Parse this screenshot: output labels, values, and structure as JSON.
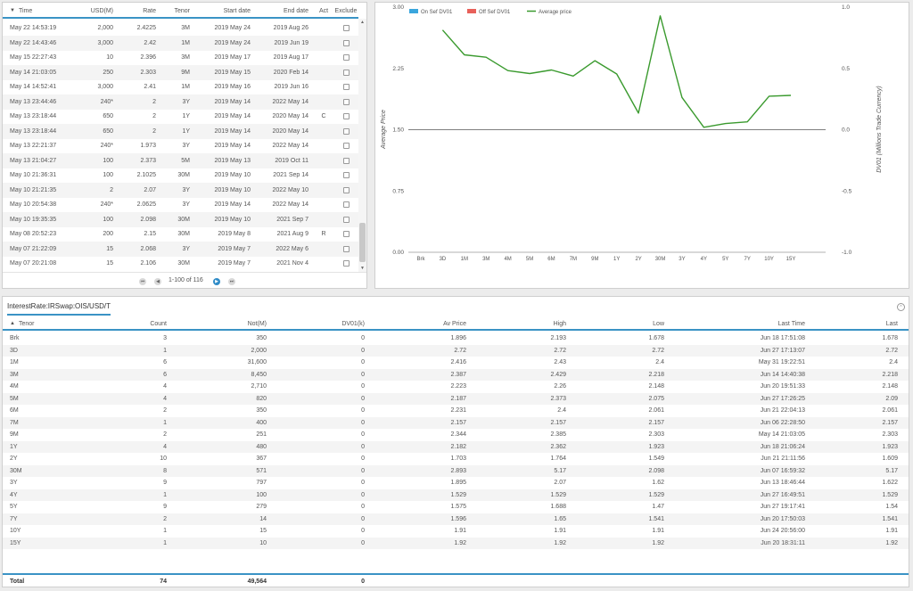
{
  "trades": {
    "columns": {
      "time": "Time",
      "usd": "USD(M)",
      "rate": "Rate",
      "tenor": "Tenor",
      "start": "Start date",
      "end": "End date",
      "act": "Act",
      "exclude": "Exclude"
    },
    "rows": [
      {
        "time": "May 22 14:53:19",
        "usd": "2,000",
        "rate": "2.4225",
        "tenor": "3M",
        "start": "2019 May 24",
        "end": "2019 Aug 26",
        "act": ""
      },
      {
        "time": "May 22 14:43:46",
        "usd": "3,000",
        "rate": "2.42",
        "tenor": "1M",
        "start": "2019 May 24",
        "end": "2019 Jun 19",
        "act": ""
      },
      {
        "time": "May 15 22:27:43",
        "usd": "10",
        "rate": "2.396",
        "tenor": "3M",
        "start": "2019 May 17",
        "end": "2019 Aug 17",
        "act": ""
      },
      {
        "time": "May 14 21:03:05",
        "usd": "250",
        "rate": "2.303",
        "tenor": "9M",
        "start": "2019 May 15",
        "end": "2020 Feb 14",
        "act": ""
      },
      {
        "time": "May 14 14:52:41",
        "usd": "3,000",
        "rate": "2.41",
        "tenor": "1M",
        "start": "2019 May 16",
        "end": "2019 Jun 16",
        "act": ""
      },
      {
        "time": "May 13 23:44:46",
        "usd": "240*",
        "rate": "2",
        "tenor": "3Y",
        "start": "2019 May 14",
        "end": "2022 May 14",
        "act": ""
      },
      {
        "time": "May 13 23:18:44",
        "usd": "650",
        "rate": "2",
        "tenor": "1Y",
        "start": "2019 May 14",
        "end": "2020 May 14",
        "act": "C"
      },
      {
        "time": "May 13 23:18:44",
        "usd": "650",
        "rate": "2",
        "tenor": "1Y",
        "start": "2019 May 14",
        "end": "2020 May 14",
        "act": ""
      },
      {
        "time": "May 13 22:21:37",
        "usd": "240*",
        "rate": "1.973",
        "tenor": "3Y",
        "start": "2019 May 14",
        "end": "2022 May 14",
        "act": ""
      },
      {
        "time": "May 13 21:04:27",
        "usd": "100",
        "rate": "2.373",
        "tenor": "5M",
        "start": "2019 May 13",
        "end": "2019 Oct 11",
        "act": ""
      },
      {
        "time": "May 10 21:36:31",
        "usd": "100",
        "rate": "2.1025",
        "tenor": "30M",
        "start": "2019 May 10",
        "end": "2021 Sep 14",
        "act": ""
      },
      {
        "time": "May 10 21:21:35",
        "usd": "2",
        "rate": "2.07",
        "tenor": "3Y",
        "start": "2019 May 10",
        "end": "2022 May 10",
        "act": ""
      },
      {
        "time": "May 10 20:54:38",
        "usd": "240*",
        "rate": "2.0625",
        "tenor": "3Y",
        "start": "2019 May 14",
        "end": "2022 May 14",
        "act": ""
      },
      {
        "time": "May 10 19:35:35",
        "usd": "100",
        "rate": "2.098",
        "tenor": "30M",
        "start": "2019 May 10",
        "end": "2021 Sep 7",
        "act": ""
      },
      {
        "time": "May 08 20:52:23",
        "usd": "200",
        "rate": "2.15",
        "tenor": "30M",
        "start": "2019 May 8",
        "end": "2021 Aug 9",
        "act": "R"
      },
      {
        "time": "May 07 21:22:09",
        "usd": "15",
        "rate": "2.068",
        "tenor": "3Y",
        "start": "2019 May 7",
        "end": "2022 May 6",
        "act": ""
      },
      {
        "time": "May 07 20:21:08",
        "usd": "15",
        "rate": "2.106",
        "tenor": "30M",
        "start": "2019 May 7",
        "end": "2021 Nov 4",
        "act": ""
      }
    ],
    "pager": {
      "label": "1-100 of 116"
    }
  },
  "chart_data": {
    "type": "line",
    "legend": [
      "On Sef DV01",
      "Off Sef DV01",
      "Average price"
    ],
    "legend_colors": [
      "#3aa6dd",
      "#e8605a",
      "#3a9a2e"
    ],
    "legend_placement": "top-left",
    "categories": [
      "Brk",
      "3D",
      "1M",
      "3M",
      "4M",
      "5M",
      "6M",
      "7M",
      "9M",
      "1Y",
      "2Y",
      "30M",
      "3Y",
      "4Y",
      "5Y",
      "7Y",
      "10Y",
      "15Y"
    ],
    "series": [
      {
        "name": "Average price",
        "axis": "left",
        "color": "#3a9a2e",
        "values": [
          null,
          2.72,
          2.416,
          2.387,
          2.223,
          2.187,
          2.231,
          2.157,
          2.344,
          2.182,
          1.703,
          2.893,
          1.895,
          1.529,
          1.575,
          1.596,
          1.91,
          1.92
        ]
      }
    ],
    "ylabel": "Average Price",
    "y2label": "DV01 (Millions Trade Currency)",
    "ylim": [
      0,
      3
    ],
    "yticks": [
      "0.00",
      "0.75",
      "1.50",
      "2.25",
      "3.00"
    ],
    "y2lim": [
      -1,
      1
    ],
    "y2ticks": [
      "-1.0",
      "-0.5",
      "0.0",
      "0.5",
      "1.0"
    ],
    "zero_line": 1.5,
    "grid": false
  },
  "summary": {
    "tab": "InterestRate:IRSwap:OIS/USD/T",
    "columns": {
      "tenor": "Tenor",
      "count": "Count",
      "not": "Not(M)",
      "dv01": "DV01(k)",
      "avprice": "Av Price",
      "high": "High",
      "low": "Low",
      "lasttime": "Last Time",
      "last": "Last"
    },
    "rows": [
      {
        "tenor": "Brk",
        "count": "3",
        "not": "350",
        "dv01": "0",
        "avprice": "1.896",
        "high": "2.193",
        "low": "1.678",
        "lasttime": "Jun 18 17:51:08",
        "last": "1.678"
      },
      {
        "tenor": "3D",
        "count": "1",
        "not": "2,000",
        "dv01": "0",
        "avprice": "2.72",
        "high": "2.72",
        "low": "2.72",
        "lasttime": "Jun 27 17:13:07",
        "last": "2.72"
      },
      {
        "tenor": "1M",
        "count": "6",
        "not": "31,600",
        "dv01": "0",
        "avprice": "2.416",
        "high": "2.43",
        "low": "2.4",
        "lasttime": "May 31 19:22:51",
        "last": "2.4"
      },
      {
        "tenor": "3M",
        "count": "6",
        "not": "8,450",
        "dv01": "0",
        "avprice": "2.387",
        "high": "2.429",
        "low": "2.218",
        "lasttime": "Jun 14 14:40:38",
        "last": "2.218"
      },
      {
        "tenor": "4M",
        "count": "4",
        "not": "2,710",
        "dv01": "0",
        "avprice": "2.223",
        "high": "2.26",
        "low": "2.148",
        "lasttime": "Jun 20 19:51:33",
        "last": "2.148"
      },
      {
        "tenor": "5M",
        "count": "4",
        "not": "820",
        "dv01": "0",
        "avprice": "2.187",
        "high": "2.373",
        "low": "2.075",
        "lasttime": "Jun 27 17:26:25",
        "last": "2.09"
      },
      {
        "tenor": "6M",
        "count": "2",
        "not": "350",
        "dv01": "0",
        "avprice": "2.231",
        "high": "2.4",
        "low": "2.061",
        "lasttime": "Jun 21 22:04:13",
        "last": "2.061"
      },
      {
        "tenor": "7M",
        "count": "1",
        "not": "400",
        "dv01": "0",
        "avprice": "2.157",
        "high": "2.157",
        "low": "2.157",
        "lasttime": "Jun 06 22:28:50",
        "last": "2.157"
      },
      {
        "tenor": "9M",
        "count": "2",
        "not": "251",
        "dv01": "0",
        "avprice": "2.344",
        "high": "2.385",
        "low": "2.303",
        "lasttime": "May 14 21:03:05",
        "last": "2.303"
      },
      {
        "tenor": "1Y",
        "count": "4",
        "not": "480",
        "dv01": "0",
        "avprice": "2.182",
        "high": "2.362",
        "low": "1.923",
        "lasttime": "Jun 18 21:06:24",
        "last": "1.923"
      },
      {
        "tenor": "2Y",
        "count": "10",
        "not": "367",
        "dv01": "0",
        "avprice": "1.703",
        "high": "1.764",
        "low": "1.549",
        "lasttime": "Jun 21 21:11:56",
        "last": "1.609"
      },
      {
        "tenor": "30M",
        "count": "8",
        "not": "571",
        "dv01": "0",
        "avprice": "2.893",
        "high": "5.17",
        "low": "2.098",
        "lasttime": "Jun 07 16:59:32",
        "last": "5.17"
      },
      {
        "tenor": "3Y",
        "count": "9",
        "not": "797",
        "dv01": "0",
        "avprice": "1.895",
        "high": "2.07",
        "low": "1.62",
        "lasttime": "Jun 13 18:46:44",
        "last": "1.622"
      },
      {
        "tenor": "4Y",
        "count": "1",
        "not": "100",
        "dv01": "0",
        "avprice": "1.529",
        "high": "1.529",
        "low": "1.529",
        "lasttime": "Jun 27 16:49:51",
        "last": "1.529"
      },
      {
        "tenor": "5Y",
        "count": "9",
        "not": "279",
        "dv01": "0",
        "avprice": "1.575",
        "high": "1.688",
        "low": "1.47",
        "lasttime": "Jun 27 19:17:41",
        "last": "1.54"
      },
      {
        "tenor": "7Y",
        "count": "2",
        "not": "14",
        "dv01": "0",
        "avprice": "1.596",
        "high": "1.65",
        "low": "1.541",
        "lasttime": "Jun 20 17:50:03",
        "last": "1.541"
      },
      {
        "tenor": "10Y",
        "count": "1",
        "not": "15",
        "dv01": "0",
        "avprice": "1.91",
        "high": "1.91",
        "low": "1.91",
        "lasttime": "Jun 24 20:56:00",
        "last": "1.91"
      },
      {
        "tenor": "15Y",
        "count": "1",
        "not": "10",
        "dv01": "0",
        "avprice": "1.92",
        "high": "1.92",
        "low": "1.92",
        "lasttime": "Jun 20 18:31:11",
        "last": "1.92"
      }
    ],
    "total": {
      "label": "Total",
      "count": "74",
      "not": "49,564",
      "dv01": "0"
    }
  }
}
